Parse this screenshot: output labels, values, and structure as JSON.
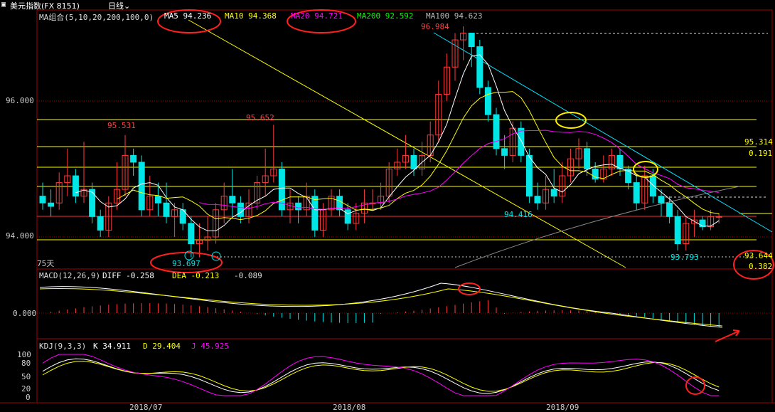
{
  "header": {
    "title": "美元指数(FX 8151)",
    "period": "日线",
    "period_chevron": "chevron-down-icon"
  },
  "main": {
    "ma_group": "MA组合(5,10,20,200,100,0)",
    "ma5": "MA5 94.236",
    "ma10": "MA10 94.368",
    "ma20": "MA20 94.721",
    "ma200": "MA200 92.592",
    "ma100": "MA100 94.623",
    "y_top": "96.000",
    "y_bottom": "94.000",
    "peak_label": "96.984",
    "label_95531": "95.531",
    "label_95652": "95.652",
    "label_94416": "94.416",
    "label_93697": "93.697",
    "label_93793": "93.793",
    "label_95314": "95.314",
    "label_0191": "0.191",
    "label_93644": "93.644",
    "label_0382": "0.382",
    "days_label": "75天"
  },
  "macd": {
    "title": "MACD(12,26,9)",
    "diff": "DIFF -0.258",
    "dea": "DEA -0.213",
    "macd": "-0.089",
    "zero": "0.000"
  },
  "kdj": {
    "title": "KDJ(9,3,3)",
    "k": "K 34.911",
    "d": "D 29.404",
    "j": "J 45.925",
    "ticks": [
      "100",
      "80",
      "50",
      "20",
      "0"
    ]
  },
  "dates": [
    "2018/07",
    "2018/08",
    "2018/09"
  ],
  "colors": {
    "up": "#ff3b3b",
    "down": "#00e5e5",
    "ma5": "#ffffff",
    "ma10": "#ffff00",
    "ma20": "#ff00ff",
    "ma100": "#bbbbbb",
    "grid": "#a00000",
    "fib": "#ffff00",
    "circle_red": "#ff2020",
    "circle_yellow": "#ffee00"
  },
  "candles": [
    [
      94.6,
      94.5,
      94.8,
      94.4
    ],
    [
      94.5,
      94.45,
      94.7,
      94.3
    ],
    [
      94.5,
      94.8,
      94.95,
      94.4
    ],
    [
      94.8,
      94.9,
      95.3,
      94.6
    ],
    [
      94.9,
      94.6,
      95.0,
      94.5
    ],
    [
      94.6,
      94.7,
      95.4,
      94.5
    ],
    [
      94.7,
      94.3,
      94.8,
      94.2
    ],
    [
      94.3,
      94.1,
      94.4,
      94.0
    ],
    [
      94.1,
      94.5,
      94.6,
      94.0
    ],
    [
      94.5,
      94.7,
      95.1,
      94.4
    ],
    [
      94.7,
      95.2,
      95.5,
      94.6
    ],
    [
      95.2,
      95.1,
      95.3,
      94.9
    ],
    [
      95.1,
      94.4,
      95.2,
      94.3
    ],
    [
      94.4,
      94.6,
      94.9,
      94.3
    ],
    [
      94.6,
      94.5,
      94.8,
      94.3
    ],
    [
      94.5,
      94.3,
      94.8,
      94.2
    ],
    [
      94.3,
      94.4,
      94.5,
      94.0
    ],
    [
      94.4,
      94.2,
      94.5,
      94.1
    ],
    [
      94.2,
      93.9,
      94.3,
      93.7
    ],
    [
      93.9,
      93.95,
      94.2,
      93.7
    ],
    [
      93.95,
      94.0,
      94.3,
      93.8
    ],
    [
      94.0,
      94.4,
      94.5,
      93.9
    ],
    [
      94.4,
      94.6,
      94.8,
      94.2
    ],
    [
      94.6,
      94.5,
      95.0,
      94.3
    ],
    [
      94.5,
      94.3,
      94.6,
      94.2
    ],
    [
      94.3,
      94.5,
      94.7,
      94.2
    ],
    [
      94.5,
      94.8,
      94.9,
      94.4
    ],
    [
      94.8,
      94.9,
      95.3,
      94.6
    ],
    [
      94.9,
      95.0,
      95.65,
      94.8
    ],
    [
      95.0,
      94.4,
      95.1,
      94.3
    ],
    [
      94.4,
      94.5,
      94.7,
      94.2
    ],
    [
      94.5,
      94.4,
      94.6,
      94.2
    ],
    [
      94.4,
      94.6,
      94.8,
      94.3
    ],
    [
      94.6,
      94.1,
      94.7,
      94.0
    ],
    [
      94.1,
      94.4,
      94.5,
      94.0
    ],
    [
      94.4,
      94.6,
      94.7,
      94.3
    ],
    [
      94.6,
      94.4,
      94.7,
      94.3
    ],
    [
      94.4,
      94.2,
      94.5,
      94.1
    ],
    [
      94.2,
      94.35,
      94.5,
      94.1
    ],
    [
      94.35,
      94.5,
      94.7,
      94.2
    ],
    [
      94.5,
      94.5,
      94.7,
      94.4
    ],
    [
      94.5,
      94.6,
      94.8,
      94.4
    ],
    [
      94.6,
      95.0,
      95.1,
      94.5
    ],
    [
      95.0,
      95.1,
      95.3,
      94.9
    ],
    [
      95.1,
      95.2,
      95.5,
      95.0
    ],
    [
      95.2,
      95.0,
      95.3,
      94.9
    ],
    [
      95.0,
      95.2,
      95.4,
      94.9
    ],
    [
      95.2,
      95.5,
      95.7,
      95.1
    ],
    [
      95.5,
      96.1,
      96.3,
      95.4
    ],
    [
      96.1,
      96.5,
      96.7,
      96.0
    ],
    [
      96.5,
      96.9,
      97.0,
      96.3
    ],
    [
      96.9,
      97.0,
      97.1,
      96.6
    ],
    [
      97.0,
      96.8,
      97.0,
      96.5
    ],
    [
      96.8,
      96.2,
      96.9,
      96.1
    ],
    [
      96.2,
      95.8,
      96.3,
      95.7
    ],
    [
      95.8,
      95.3,
      95.9,
      95.2
    ],
    [
      95.3,
      95.2,
      95.5,
      95.0
    ],
    [
      95.2,
      95.6,
      95.7,
      95.1
    ],
    [
      95.6,
      95.2,
      95.7,
      95.1
    ],
    [
      95.2,
      94.6,
      95.3,
      94.5
    ],
    [
      94.6,
      94.5,
      94.8,
      94.4
    ],
    [
      94.5,
      94.7,
      94.9,
      94.4
    ],
    [
      94.7,
      94.6,
      95.0,
      94.5
    ],
    [
      94.6,
      94.9,
      95.1,
      94.5
    ],
    [
      94.9,
      95.15,
      95.3,
      94.8
    ],
    [
      95.15,
      95.3,
      95.45,
      95.0
    ],
    [
      95.3,
      95.0,
      95.4,
      94.9
    ],
    [
      95.0,
      94.85,
      95.1,
      94.8
    ],
    [
      94.85,
      95.0,
      95.2,
      94.8
    ],
    [
      95.0,
      95.2,
      95.3,
      94.9
    ],
    [
      95.2,
      95.0,
      95.3,
      94.9
    ],
    [
      95.0,
      94.8,
      95.05,
      94.7
    ],
    [
      94.8,
      94.5,
      94.9,
      94.4
    ],
    [
      94.5,
      94.9,
      95.05,
      94.4
    ],
    [
      94.9,
      94.6,
      95.0,
      94.5
    ],
    [
      94.6,
      94.5,
      94.7,
      94.3
    ],
    [
      94.5,
      94.3,
      94.6,
      94.2
    ],
    [
      94.3,
      93.9,
      94.4,
      93.8
    ],
    [
      93.9,
      94.2,
      94.3,
      93.8
    ],
    [
      94.2,
      94.25,
      94.4,
      94.0
    ],
    [
      94.25,
      94.15,
      94.3,
      94.1
    ],
    [
      94.15,
      94.3,
      94.4,
      94.1
    ],
    [
      94.3,
      94.3,
      94.35,
      94.2
    ]
  ]
}
